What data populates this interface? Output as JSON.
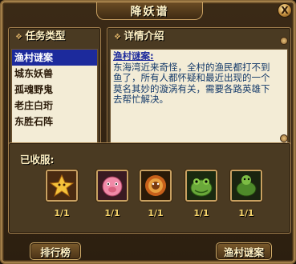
{
  "window": {
    "title": "降妖谱"
  },
  "close_label": "X",
  "task_types": {
    "header": "任务类型",
    "items": [
      "渔村谜案",
      "城东妖兽",
      "孤魂野鬼",
      "老庄白珩",
      "东胜石阵"
    ],
    "selected_index": 0
  },
  "details": {
    "header": "详情介绍",
    "title": "渔村谜案:",
    "body": "东海湾近来奇怪，全村的渔民都打不到鱼了，所有人都怀疑和最近出现的一个莫名其妙的漩涡有关，需要各路英雄下去帮忙解决。"
  },
  "collected": {
    "label": "已收服:",
    "monsters": [
      {
        "icon": "yellow-star-monster-icon",
        "count": "1/1"
      },
      {
        "icon": "pink-pig-monster-icon",
        "count": "1/1"
      },
      {
        "icon": "fire-lion-monster-icon",
        "count": "1/1"
      },
      {
        "icon": "green-frog-monster-icon",
        "count": "1/1"
      },
      {
        "icon": "green-turtle-monster-icon",
        "count": "1/1"
      }
    ]
  },
  "buttons": {
    "rank": "排行榜",
    "current": "渔村谜案"
  },
  "colors": {
    "selected_bg": "#1c2a9c",
    "accent_gold": "#c9a162",
    "count_text": "#f5d36b"
  }
}
